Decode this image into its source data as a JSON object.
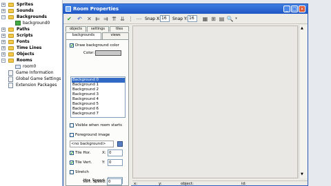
{
  "tree": {
    "sprites": "Sprites",
    "sounds": "Sounds",
    "backgrounds": "Backgrounds",
    "background0": "background0",
    "paths": "Paths",
    "scripts": "Scripts",
    "fonts": "Fonts",
    "timelines": "Time Lines",
    "objects": "Objects",
    "rooms": "Rooms",
    "room0": "room0",
    "gameinfo": "Game Information",
    "globalsettings": "Global Game Settings",
    "extpackages": "Extension Packages"
  },
  "window": {
    "title": "Room Properties"
  },
  "toolbar": {
    "snapx_label": "Snap X:",
    "snapx_value": "16",
    "snapy_label": "Snap Y:",
    "snapy_value": "16"
  },
  "tabs": {
    "objects": "objects",
    "settings": "settings",
    "tiles": "tiles",
    "backgrounds": "backgrounds",
    "views": "views"
  },
  "panel": {
    "draw_bg_color": "Draw background color",
    "color_label": "Color:",
    "bg_color": "#c8c8c8",
    "list": [
      "Background 0",
      "Background 1",
      "Background 2",
      "Background 3",
      "Background 4",
      "Background 5",
      "Background 6",
      "Background 7"
    ],
    "visible_start": "Visible when room starts",
    "foreground": "Foreground image",
    "no_bg": "<no background>",
    "tile_hor": "Tile Hor.",
    "x_label": "X:",
    "x_value": "0",
    "tile_vert": "Tile Vert.",
    "y_label": "Y:",
    "y_value": "0",
    "stretch": "Stretch",
    "hspeed_label": "Hor. Speed:",
    "hspeed_value": "0",
    "vspeed_label": "Vert. Speed:",
    "vspeed_value": "0"
  },
  "status": {
    "x": "x:",
    "y": "y:",
    "object": "object:",
    "id": "id:"
  }
}
